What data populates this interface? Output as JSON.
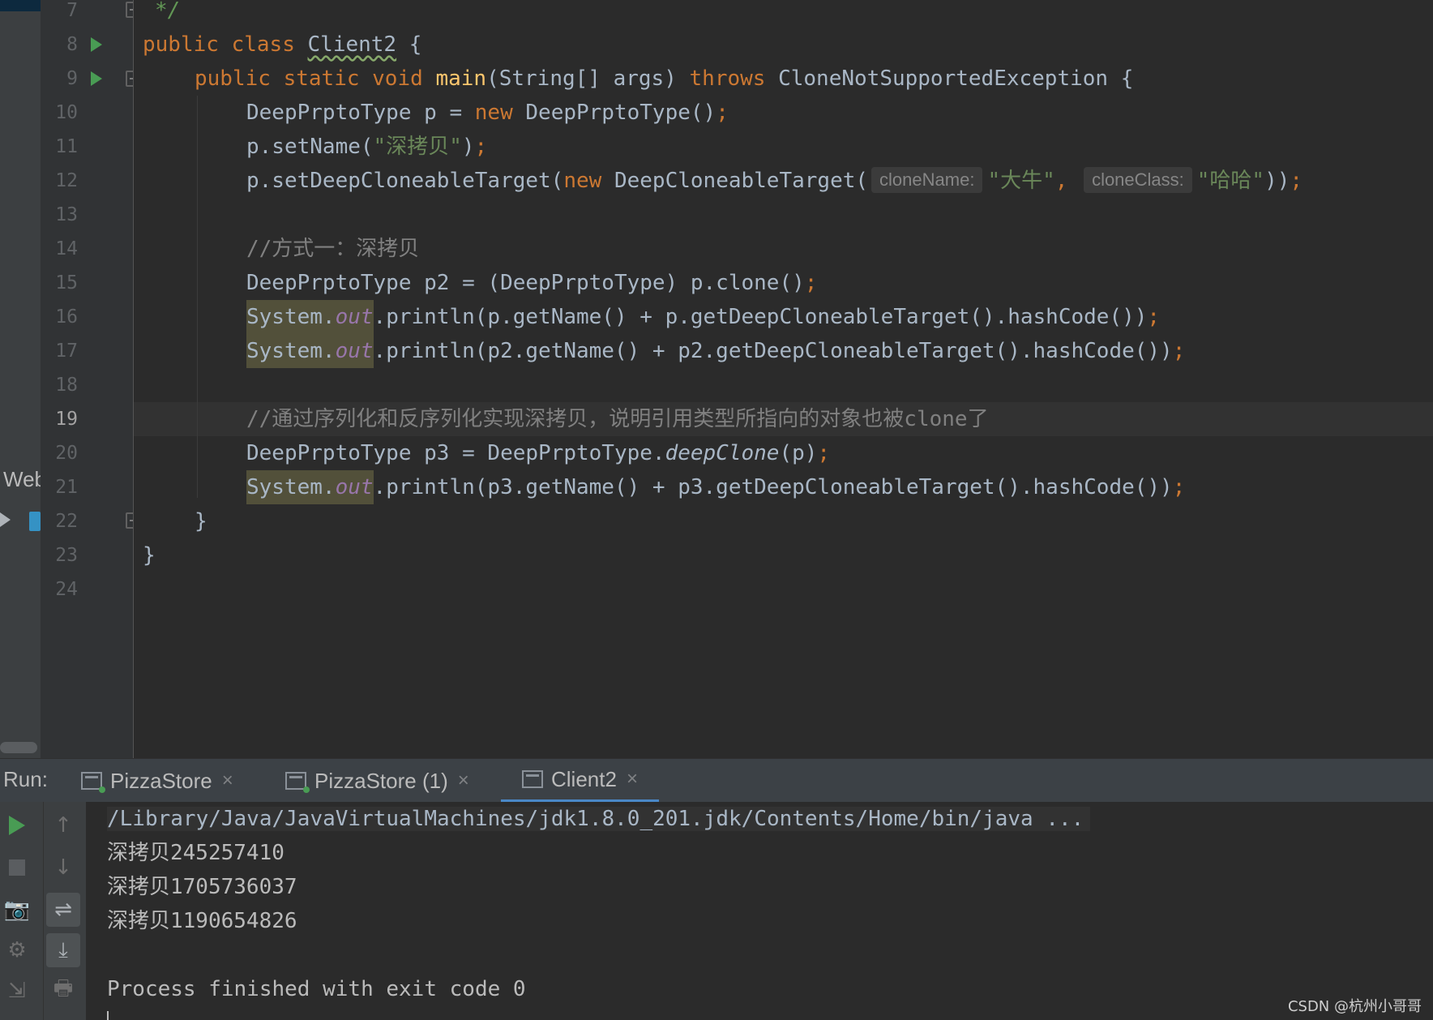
{
  "left_strip": {
    "web_label": "Web"
  },
  "editor": {
    "line_numbers": [
      "7",
      "8",
      "9",
      "10",
      "11",
      "12",
      "13",
      "14",
      "15",
      "16",
      "17",
      "18",
      "19",
      "20",
      "21",
      "22",
      "23",
      "24"
    ],
    "current_line": "19",
    "lines": {
      "l7": "*/",
      "l8": {
        "kw1": "public",
        "kw2": "class",
        "name": "Client2",
        "brace": " {"
      },
      "l9": {
        "kw1": "public",
        "kw2": "static",
        "kw3": "void",
        "fn": "main",
        "params": "(String[] args) ",
        "kw4": "throws",
        "exc": " CloneNotSupportedException {"
      },
      "l10": {
        "a": "DeepPrptoType p = ",
        "kw": "new",
        "b": " DeepPrptoType()",
        "semi": ";"
      },
      "l11": {
        "a": "p.setName(",
        "str": "\"深拷贝\"",
        "b": ")",
        "semi": ";"
      },
      "l12": {
        "a": "p.setDeepCloneableTarget(",
        "kw": "new",
        "b": " DeepCloneableTarget(",
        "hint1": "cloneName:",
        "str1": "\"大牛\"",
        "comma": ",",
        "hint2": "cloneClass:",
        "str2": "\"哈哈\"",
        "c": "))",
        "semi": ";"
      },
      "l14": "//方式一：深拷贝",
      "l15": {
        "a": "DeepPrptoType p2 = (DeepPrptoType) p.clone()",
        "semi": ";"
      },
      "l16": {
        "sys": "System.",
        "out": "out",
        "rest": ".println(p.getName() + p.getDeepCloneableTarget().hashCode())",
        "semi": ";"
      },
      "l17": {
        "sys": "System.",
        "out": "out",
        "rest": ".println(p2.getName() + p2.getDeepCloneableTarget().hashCode())",
        "semi": ";"
      },
      "l19": "//通过序列化和反序列化实现深拷贝，说明引用类型所指向的对象也被clone了",
      "l20": {
        "a": "DeepPrptoType p3 = DeepPrptoType.",
        "it": "deepClone",
        "b": "(p)",
        "semi": ";"
      },
      "l21": {
        "sys": "System.",
        "out": "out",
        "rest": ".println(p3.getName() + p3.getDeepCloneableTarget().hashCode())",
        "semi": ";"
      },
      "l22": "}",
      "l23": "}"
    }
  },
  "run_window": {
    "label": "Run:",
    "tabs": [
      {
        "label": "PizzaStore",
        "close": "×"
      },
      {
        "label": "PizzaStore (1)",
        "close": "×"
      },
      {
        "label": "Client2",
        "close": "×",
        "active": true
      }
    ],
    "console": {
      "command": "/Library/Java/JavaVirtualMachines/jdk1.8.0_201.jdk/Contents/Home/bin/java ...",
      "output": [
        "深拷贝245257410",
        "深拷贝1705736037",
        "深拷贝1190654826"
      ],
      "exit": "Process finished with exit code 0"
    }
  },
  "icons": {
    "up": "↑",
    "down": "↓",
    "camera": "📷",
    "gear": "⚙",
    "wrap": "⇌",
    "scroll_end": "⤓",
    "exit": "⇲",
    "print": "🖶"
  },
  "watermark": "CSDN @杭州小哥哥",
  "colors": {
    "background": "#2b2b2b",
    "keyword": "#cc7832",
    "string": "#6a8759",
    "comment": "#808080",
    "function": "#ffc66d",
    "field": "#9876aa",
    "run_green": "#499c54",
    "active_tab": "#4a88c7"
  }
}
